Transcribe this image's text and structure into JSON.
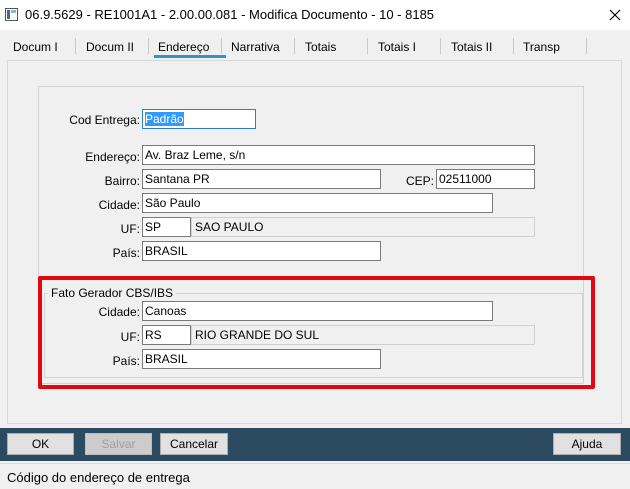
{
  "window": {
    "title": "06.9.5629 - RE1001A1 - 2.00.00.081 - Modifica Documento - 10 - 8185"
  },
  "tabs": [
    {
      "label": "Docum I"
    },
    {
      "label": "Docum II"
    },
    {
      "label": "Endereço",
      "active": true
    },
    {
      "label": "Narrativa"
    },
    {
      "label": "Totais"
    },
    {
      "label": "Totais I"
    },
    {
      "label": "Totais II"
    },
    {
      "label": "Transp"
    }
  ],
  "form": {
    "cod_entrega": {
      "label": "Cod Entrega:",
      "value": "Padrão"
    },
    "endereco": {
      "label": "Endereço:",
      "value": "Av. Braz Leme, s/n"
    },
    "bairro": {
      "label": "Bairro:",
      "value": "Santana PR"
    },
    "cep": {
      "label": "CEP:",
      "value": "02511000"
    },
    "cidade": {
      "label": "Cidade:",
      "value": "São Paulo"
    },
    "uf": {
      "label": "UF:",
      "value": "SP",
      "desc": "SAO PAULO"
    },
    "pais": {
      "label": "País:",
      "value": "BRASIL"
    }
  },
  "fato_gerador": {
    "title": "Fato Gerador CBS/IBS",
    "cidade": {
      "label": "Cidade:",
      "value": "Canoas"
    },
    "uf": {
      "label": "UF:",
      "value": "RS",
      "desc": "RIO GRANDE DO SUL"
    },
    "pais": {
      "label": "País:",
      "value": "BRASIL"
    }
  },
  "buttons": {
    "ok": "OK",
    "salvar": "Salvar",
    "cancelar": "Cancelar",
    "ajuda": "Ajuda"
  },
  "status": {
    "text": "Código do endereço de entrega"
  },
  "colors": {
    "accent": "#2a98c9",
    "highlight": "#e30613",
    "bottombar": "#2c4a60"
  }
}
